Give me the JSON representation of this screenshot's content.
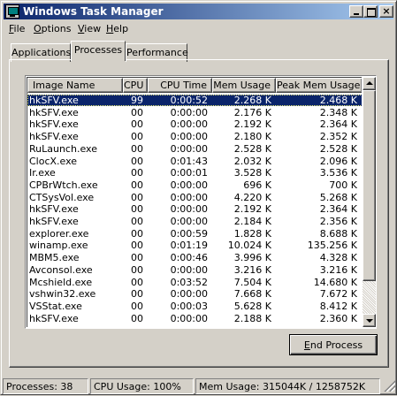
{
  "window": {
    "title": "Windows Task Manager",
    "colors": {
      "titlebar_start": "#0a246a",
      "titlebar_end": "#a6caf0",
      "face": "#d4d0c8",
      "selection": "#0a246a"
    },
    "caption_buttons": {
      "minimize": "minimize-icon",
      "maximize": "maximize-icon",
      "close": "×"
    }
  },
  "menu": [
    {
      "mnemonic": "F",
      "rest": "ile"
    },
    {
      "mnemonic": "O",
      "rest": "ptions"
    },
    {
      "mnemonic": "V",
      "rest": "iew"
    },
    {
      "mnemonic": "H",
      "rest": "elp"
    }
  ],
  "tabs": [
    "Applications",
    "Processes",
    "Performance"
  ],
  "active_tab": "Processes",
  "table": {
    "columns": [
      "Image Name",
      "CPU",
      "CPU Time",
      "Mem Usage",
      "Peak Mem Usage"
    ],
    "rows": [
      [
        "hkSFV.exe",
        "99",
        "0:00:52",
        "2.268 K",
        "2.468 K"
      ],
      [
        "hkSFV.exe",
        "00",
        "0:00:00",
        "2.176 K",
        "2.348 K"
      ],
      [
        "hkSFV.exe",
        "00",
        "0:00:00",
        "2.192 K",
        "2.364 K"
      ],
      [
        "hkSFV.exe",
        "00",
        "0:00:00",
        "2.180 K",
        "2.352 K"
      ],
      [
        "RuLaunch.exe",
        "00",
        "0:00:00",
        "2.528 K",
        "2.528 K"
      ],
      [
        "ClocX.exe",
        "00",
        "0:01:43",
        "2.032 K",
        "2.096 K"
      ],
      [
        "Ir.exe",
        "00",
        "0:00:01",
        "3.528 K",
        "3.536 K"
      ],
      [
        "CPBrWtch.exe",
        "00",
        "0:00:00",
        "696 K",
        "700 K"
      ],
      [
        "CTSysVol.exe",
        "00",
        "0:00:00",
        "4.220 K",
        "5.268 K"
      ],
      [
        "hkSFV.exe",
        "00",
        "0:00:00",
        "2.192 K",
        "2.364 K"
      ],
      [
        "hkSFV.exe",
        "00",
        "0:00:00",
        "2.184 K",
        "2.356 K"
      ],
      [
        "explorer.exe",
        "00",
        "0:00:59",
        "1.828 K",
        "8.688 K"
      ],
      [
        "winamp.exe",
        "00",
        "0:01:19",
        "10.024 K",
        "135.256 K"
      ],
      [
        "MBM5.exe",
        "00",
        "0:00:46",
        "3.996 K",
        "4.328 K"
      ],
      [
        "Avconsol.exe",
        "00",
        "0:00:00",
        "3.216 K",
        "3.216 K"
      ],
      [
        "Mcshield.exe",
        "00",
        "0:03:52",
        "7.504 K",
        "14.680 K"
      ],
      [
        "vshwin32.exe",
        "00",
        "0:00:00",
        "7.668 K",
        "7.672 K"
      ],
      [
        "VSStat.exe",
        "00",
        "0:00:03",
        "5.628 K",
        "8.412 K"
      ],
      [
        "hkSFV.exe",
        "00",
        "0:00:00",
        "2.188 K",
        "2.360 K"
      ]
    ],
    "selected_row": 0
  },
  "end_process_button": {
    "mnemonic": "E",
    "rest": "nd Process"
  },
  "status": {
    "processes": "Processes: 38",
    "cpu_usage": "CPU Usage: 100%",
    "mem_usage": "Mem Usage: 315044K / 1258752K"
  }
}
